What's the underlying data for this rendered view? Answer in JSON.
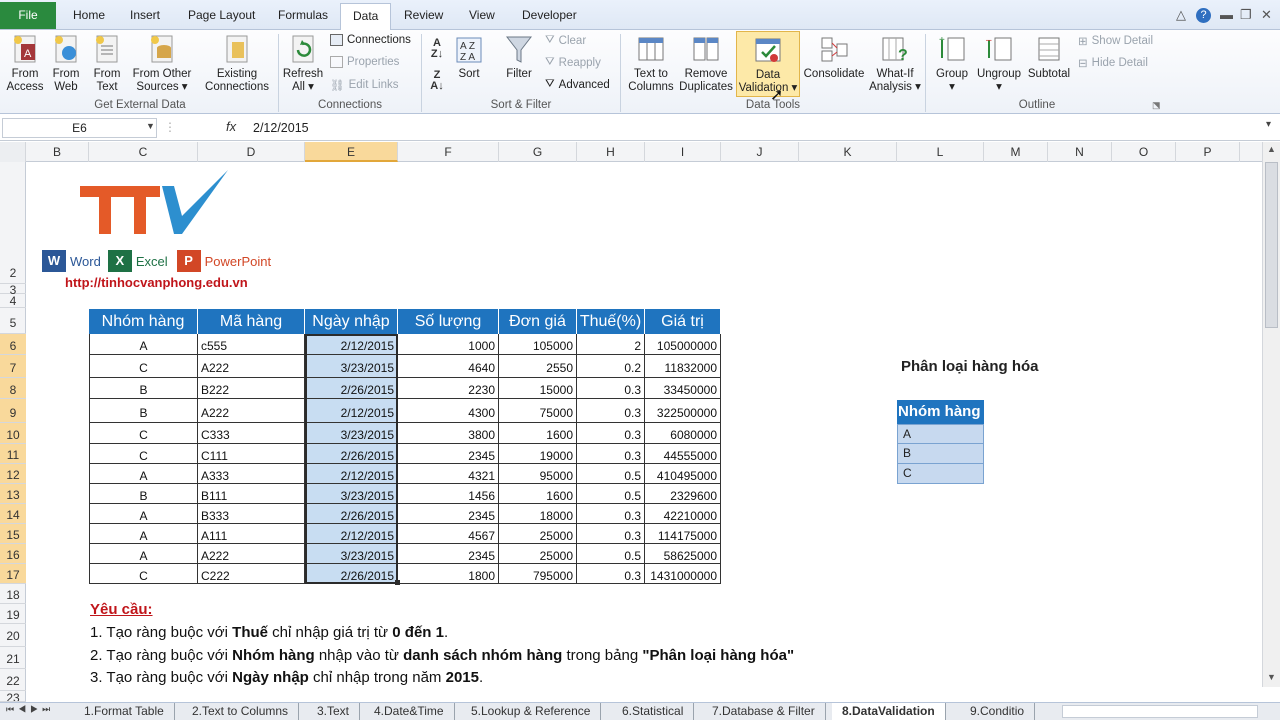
{
  "tabs": {
    "file": "File",
    "home": "Home",
    "insert": "Insert",
    "page_layout": "Page Layout",
    "formulas": "Formulas",
    "data": "Data",
    "review": "Review",
    "view": "View",
    "developer": "Developer"
  },
  "ribbon": {
    "from_access": [
      "From",
      "Access"
    ],
    "from_web": [
      "From",
      "Web"
    ],
    "from_text": [
      "From",
      "Text"
    ],
    "from_other": [
      "From Other",
      "Sources"
    ],
    "existing": [
      "Existing",
      "Connections"
    ],
    "refresh": [
      "Refresh",
      "All"
    ],
    "connections": "Connections",
    "properties": "Properties",
    "edit_links": "Edit Links",
    "sort": "Sort",
    "filter": "Filter",
    "clear": "Clear",
    "reapply": "Reapply",
    "advanced": "Advanced",
    "text_to_columns": [
      "Text to",
      "Columns"
    ],
    "remove_duplicates": [
      "Remove",
      "Duplicates"
    ],
    "data_validation": [
      "Data",
      "Validation"
    ],
    "consolidate": "Consolidate",
    "what_if": [
      "What-If",
      "Analysis"
    ],
    "group": "Group",
    "ungroup": "Ungroup",
    "subtotal": "Subtotal",
    "show_detail": "Show Detail",
    "hide_detail": "Hide Detail",
    "groups": {
      "external": "Get External Data",
      "connections": "Connections",
      "sort_filter": "Sort & Filter",
      "data_tools": "Data Tools",
      "outline": "Outline"
    }
  },
  "formula_bar": {
    "name_box": "E6",
    "fx": "fx",
    "value": "2/12/2015"
  },
  "columns": [
    "B",
    "C",
    "D",
    "E",
    "F",
    "G",
    "H",
    "I",
    "J",
    "K",
    "L",
    "M",
    "N",
    "O",
    "P"
  ],
  "rows": [
    "2",
    "3",
    "4",
    "5",
    "6",
    "7",
    "8",
    "9",
    "10",
    "11",
    "12",
    "13",
    "14",
    "15",
    "16",
    "17",
    "18",
    "19",
    "20",
    "21",
    "22",
    "23"
  ],
  "logo": {
    "apps": [
      "Word",
      "Excel",
      "PowerPoint"
    ],
    "url": "http://tinhocvanphong.edu.vn"
  },
  "table": {
    "headers": [
      "Nhóm hàng",
      "Mã hàng",
      "Ngày nhập",
      "Số lượng",
      "Đơn giá",
      "Thuế(%)",
      "Giá trị"
    ],
    "rows": [
      [
        "A",
        "c555",
        "2/12/2015",
        "1000",
        "105000",
        "2",
        "105000000"
      ],
      [
        "C",
        "A222",
        "3/23/2015",
        "4640",
        "2550",
        "0.2",
        "11832000"
      ],
      [
        "B",
        "B222",
        "2/26/2015",
        "2230",
        "15000",
        "0.3",
        "33450000"
      ],
      [
        "B",
        "A222",
        "2/12/2015",
        "4300",
        "75000",
        "0.3",
        "322500000"
      ],
      [
        "C",
        "C333",
        "3/23/2015",
        "3800",
        "1600",
        "0.3",
        "6080000"
      ],
      [
        "C",
        "C111",
        "2/26/2015",
        "2345",
        "19000",
        "0.3",
        "44555000"
      ],
      [
        "A",
        "A333",
        "2/12/2015",
        "4321",
        "95000",
        "0.5",
        "410495000"
      ],
      [
        "B",
        "B111",
        "3/23/2015",
        "1456",
        "1600",
        "0.5",
        "2329600"
      ],
      [
        "A",
        "B333",
        "2/26/2015",
        "2345",
        "18000",
        "0.3",
        "42210000"
      ],
      [
        "A",
        "A111",
        "2/12/2015",
        "4567",
        "25000",
        "0.3",
        "114175000"
      ],
      [
        "A",
        "A222",
        "3/23/2015",
        "2345",
        "25000",
        "0.5",
        "58625000"
      ],
      [
        "C",
        "C222",
        "2/26/2015",
        "1800",
        "795000",
        "0.3",
        "1431000000"
      ]
    ]
  },
  "classify": {
    "title": "Phân loại hàng hóa",
    "header": "Nhóm hàng",
    "items": [
      "A",
      "B",
      "C"
    ]
  },
  "requirements": {
    "title": "Yêu cầu:",
    "lines": [
      [
        {
          "t": "1. Tạo ràng buộc với "
        },
        {
          "t": "Thuế",
          "b": true
        },
        {
          "t": "  chỉ nhập giá trị từ "
        },
        {
          "t": "0 đến 1",
          "b": true
        },
        {
          "t": "."
        }
      ],
      [
        {
          "t": "2. Tạo ràng buộc với "
        },
        {
          "t": "Nhóm hàng",
          "b": true
        },
        {
          "t": " nhập vào từ "
        },
        {
          "t": "danh sách nhóm hàng",
          "b": true
        },
        {
          "t": " trong bảng "
        },
        {
          "t": "\"Phân loại hàng hóa\"",
          "b": true
        }
      ],
      [
        {
          "t": "3. Tạo ràng buộc với "
        },
        {
          "t": "Ngày nhập",
          "b": true
        },
        {
          "t": " chỉ nhập trong năm "
        },
        {
          "t": "2015",
          "b": true
        },
        {
          "t": "."
        }
      ]
    ]
  },
  "sheet_tabs": [
    "1.Format Table",
    "2.Text to Columns",
    "3.Text",
    "4.Date&Time",
    "5.Lookup & Reference",
    "6.Statistical",
    "7.Database & Filter",
    "8.DataValidation",
    "9.Conditio"
  ],
  "active_sheet": "8.DataValidation"
}
